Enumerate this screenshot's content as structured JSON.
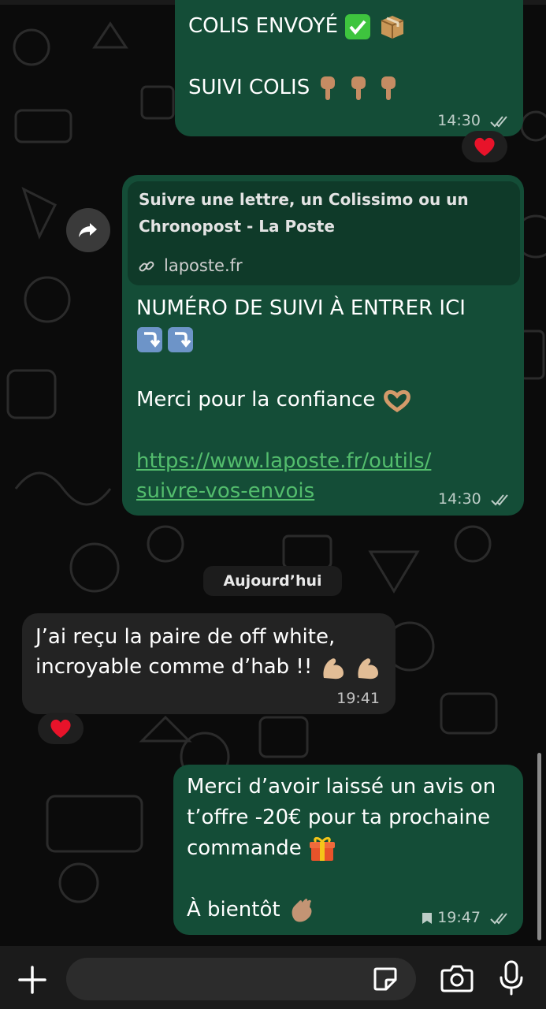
{
  "messages": {
    "m1": {
      "line1": "COLIS ENVOYÉ",
      "line2": "SUIVI COLIS",
      "time": "14:30"
    },
    "m2": {
      "preview_title_1": "Suivre une lettre, un Colissimo ou un",
      "preview_title_2": "Chronopost - La Poste",
      "preview_domain": "laposte.fr",
      "line1": "NUMÉRO DE SUIVI À ENTRER ICI",
      "line3": "Merci pour la confiance",
      "link_1": "https://www.laposte.fr/outils/",
      "link_2": "suivre-vos-envois",
      "time": "14:30"
    },
    "date_separator": "Aujourd’hui",
    "m3": {
      "line1": "J’ai reçu la paire de off white,",
      "line2": "incroyable comme d’hab !!",
      "time": "19:41"
    },
    "m4": {
      "line1": "Merci d’avoir laissé un avis on",
      "line2": "t’offre -20€ pour ta prochaine",
      "line3": "commande",
      "line4": "À bientôt",
      "time": "19:47"
    }
  },
  "reactions": {
    "m1": "heart",
    "m3": "heart"
  },
  "icons": [
    "forward-icon",
    "link-icon",
    "check-mark-emoji",
    "package-emoji",
    "pointing-hand-emoji",
    "down-arrow-emoji",
    "heart-hands-emoji",
    "flexed-biceps-emoji",
    "gift-emoji",
    "waving-hand-emoji",
    "bookmark-icon",
    "double-check-icon",
    "heart-icon",
    "plus-icon",
    "sticker-icon",
    "camera-icon",
    "microphone-icon"
  ],
  "colors": {
    "outgoing_bubble": "#144d37",
    "incoming_bubble": "#232323",
    "link": "#53bd6d",
    "background": "#0b0b0b"
  }
}
